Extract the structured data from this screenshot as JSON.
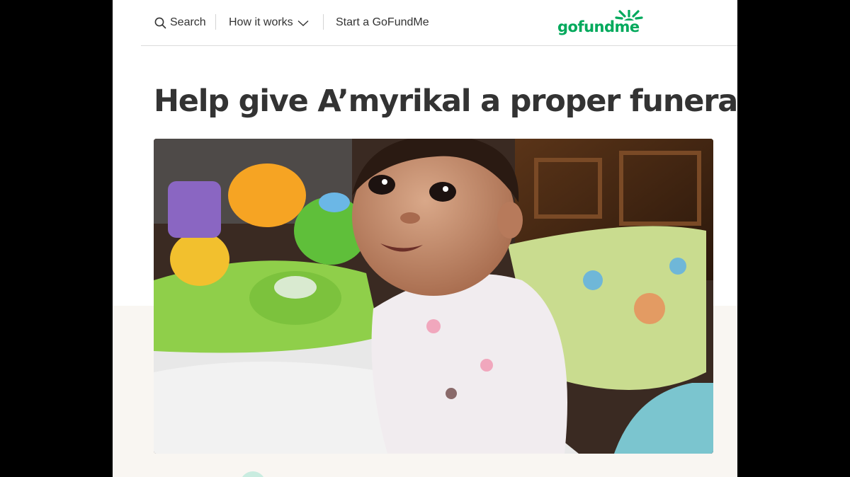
{
  "header": {
    "search_label": "Search",
    "how_it_works_label": "How it works",
    "start_label": "Start a GoFundMe",
    "logo_text": "gofundme",
    "brand_color": "#02a95c"
  },
  "campaign": {
    "title": "Help give A’myrikal a proper funeral"
  },
  "icons": {
    "search": "search-icon",
    "chevron": "chevron-down-icon"
  }
}
